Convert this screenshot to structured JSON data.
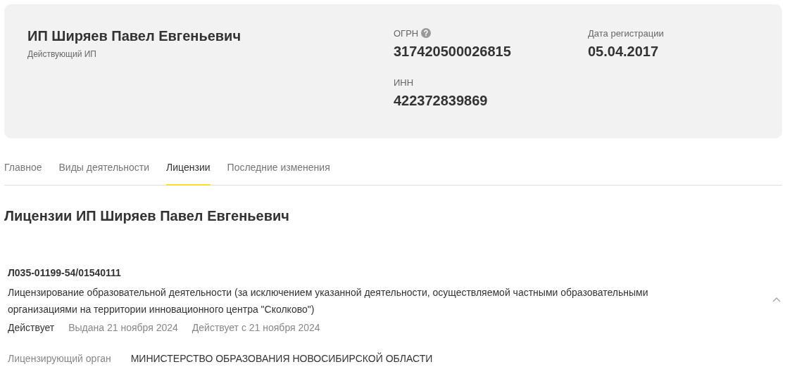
{
  "company": {
    "name": "ИП Ширяев Павел Евгеньевич",
    "status": "Действующий ИП"
  },
  "fields": [
    {
      "label": "ОГРН",
      "help": true,
      "value": "317420500026815"
    },
    {
      "label": "Дата регистрации",
      "help": false,
      "value": "05.04.2017"
    },
    {
      "label": "ИНН",
      "help": false,
      "value": "422372839869"
    }
  ],
  "tabs": [
    {
      "label": "Главное",
      "selected": false
    },
    {
      "label": "Виды деятельности",
      "selected": false
    },
    {
      "label": "Лицензии",
      "selected": true
    },
    {
      "label": "Последние изменения",
      "selected": false
    }
  ],
  "section_title": "Лицензии ИП Ширяев Павел Евгеньевич",
  "licenses": [
    {
      "number": "Л035-01199-54/01540111",
      "description": "Лицензирование образовательной деятельности (за исключением указанной деятельности, осуществляемой частными образовательными организациями на территории инновационного центра \"Сколково\")",
      "status": "Действует",
      "issued": "Выдана 21 ноября 2024",
      "valid_from": "Действует с 21 ноября 2024",
      "expanded": true,
      "details": [
        {
          "label": "Лицензирующий орган",
          "value": "МИНИСТЕРСТВО ОБРАЗОВАНИЯ НОВОСИБИРСКОЙ ОБЛАСТИ"
        }
      ]
    }
  ]
}
